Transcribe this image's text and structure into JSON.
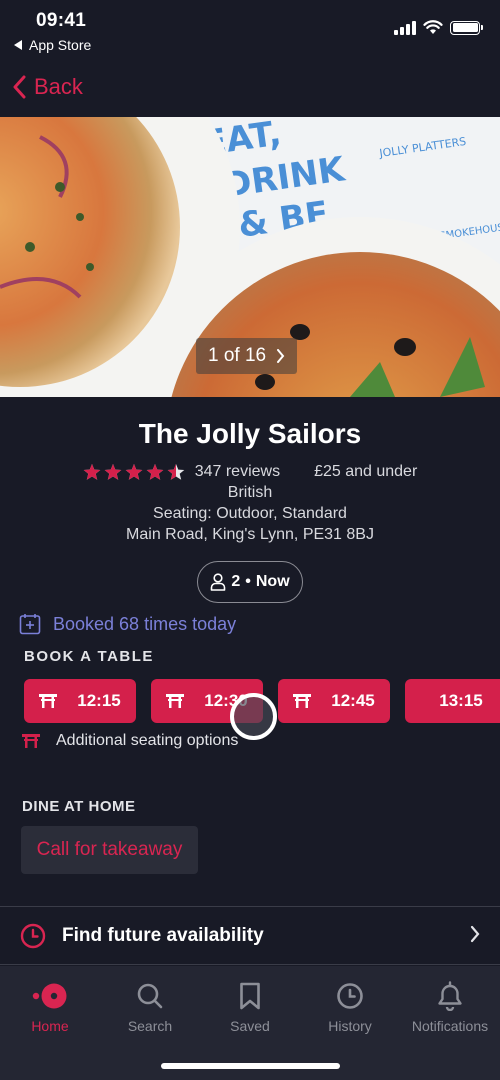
{
  "status_bar": {
    "time": "09:41",
    "back_app": "App Store",
    "icons": [
      "cellular-signal-icon",
      "wifi-icon",
      "battery-icon"
    ]
  },
  "nav": {
    "back_label": "Back"
  },
  "hero": {
    "photo_counter": "1 of 16",
    "current_photo": 1,
    "total_photos": 16
  },
  "restaurant": {
    "name": "The Jolly Sailors",
    "rating": 4.5,
    "rating_max": 5,
    "reviews": "347 reviews",
    "price": "£25 and under",
    "cuisine": "British",
    "seating": "Seating: Outdoor, Standard",
    "address": "Main Road, King's Lynn, PE31 8BJ"
  },
  "party": {
    "size": "2",
    "separator": "•",
    "time": "Now"
  },
  "booked_today": "Booked 68 times today",
  "book_table": {
    "heading": "BOOK A TABLE",
    "slots": [
      {
        "time": "12:15",
        "icon": "table-icon"
      },
      {
        "time": "12:30",
        "icon": "table-icon"
      },
      {
        "time": "12:45",
        "icon": "table-icon"
      },
      {
        "time": "13:15",
        "icon": ""
      }
    ],
    "additional_seating": "Additional seating options"
  },
  "dine_at_home": {
    "heading": "DINE AT HOME",
    "takeaway_button": "Call for takeaway"
  },
  "future_availability": "Find future availability",
  "tabbar": {
    "items": [
      {
        "label": "Home",
        "icon": "home-icon",
        "active": true
      },
      {
        "label": "Search",
        "icon": "search-icon",
        "active": false
      },
      {
        "label": "Saved",
        "icon": "bookmark-icon",
        "active": false
      },
      {
        "label": "History",
        "icon": "clock-icon",
        "active": false
      },
      {
        "label": "Notifications",
        "icon": "bell-icon",
        "active": false
      }
    ]
  },
  "colors": {
    "background": "#181a26",
    "accent": "#d4204b",
    "link_blue": "#7b80d8",
    "tabbar": "#242633",
    "muted": "#8d8f98"
  }
}
